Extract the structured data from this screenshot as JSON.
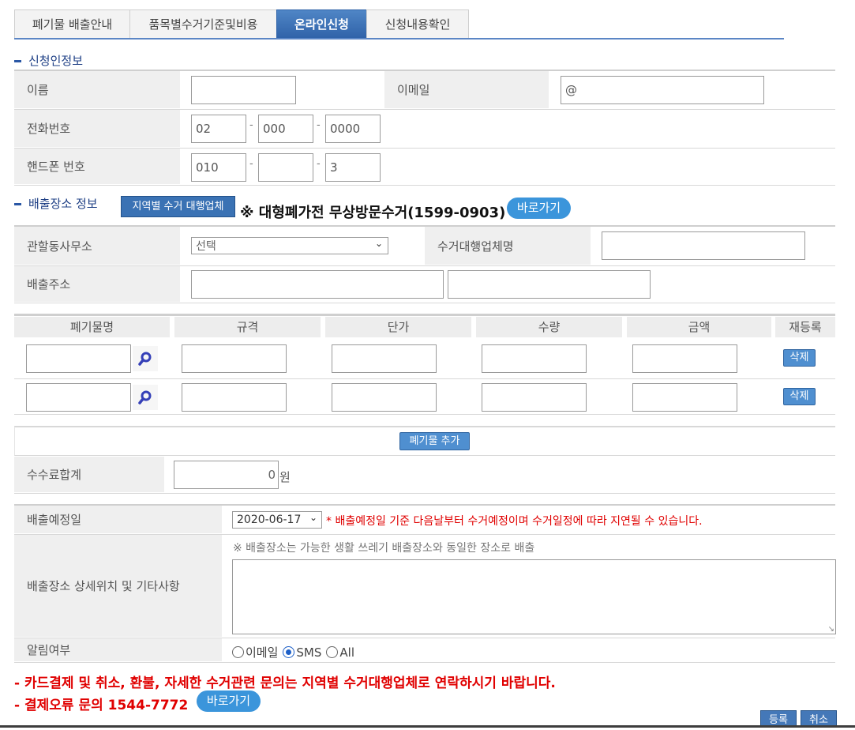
{
  "tabs": [
    "폐기물 배출안내",
    "품목별수거기준및비용",
    "온라인신청",
    "신청내용확인"
  ],
  "sections": {
    "applicant": "신청인정보",
    "location": "배출장소 정보"
  },
  "applicant": {
    "name_label": "이름",
    "email_label": "이메일",
    "email_value": "@",
    "phone_label": "전화번호",
    "phone": [
      "02",
      "000",
      "0000"
    ],
    "mobile_label": "핸드폰 번호",
    "mobile": [
      "010",
      "",
      "3"
    ],
    "separator": "-"
  },
  "location": {
    "vendor_button": "지역별 수거 대행업체",
    "notice": "※ 대형폐가전 무상방문수거(1599-0903)",
    "go_button": "바로가기",
    "office_label": "관할동사무소",
    "office_select": "선택",
    "vendor_label": "수거대행업체명",
    "address_label": "배출주소"
  },
  "waste_table": {
    "headers": [
      "폐기물명",
      "규격",
      "단가",
      "수량",
      "금액",
      "재등록"
    ],
    "delete_label": "삭제",
    "add_button": "폐기물 추가"
  },
  "fee": {
    "label": "수수료합계",
    "value": "0",
    "unit": "원"
  },
  "schedule": {
    "label": "배출예정일",
    "date": "2020-06-17",
    "notice": "* 배출예정일 기준 다음날부터 수거예정이며 수거일정에 따라 지연될 수 있습니다."
  },
  "detail": {
    "label": "배출장소 상세위치 및 기타사항",
    "hint": "※ 배출장소는 가능한 생활 쓰레기 배출장소와 동일한 장소로 배출"
  },
  "notify": {
    "label": "알림여부",
    "options": [
      "이메일",
      "SMS",
      "All"
    ],
    "selected": "SMS"
  },
  "footer": {
    "line1": "- 카드결제 및 취소, 환불, 자세한 수거관련 문의는 지역별 수거대행업체로 연락하시기 바랍니다.",
    "line2": "- 결제오류 문의 1544-7772",
    "go_button": "바로가기",
    "register": "등록",
    "cancel": "취소"
  }
}
